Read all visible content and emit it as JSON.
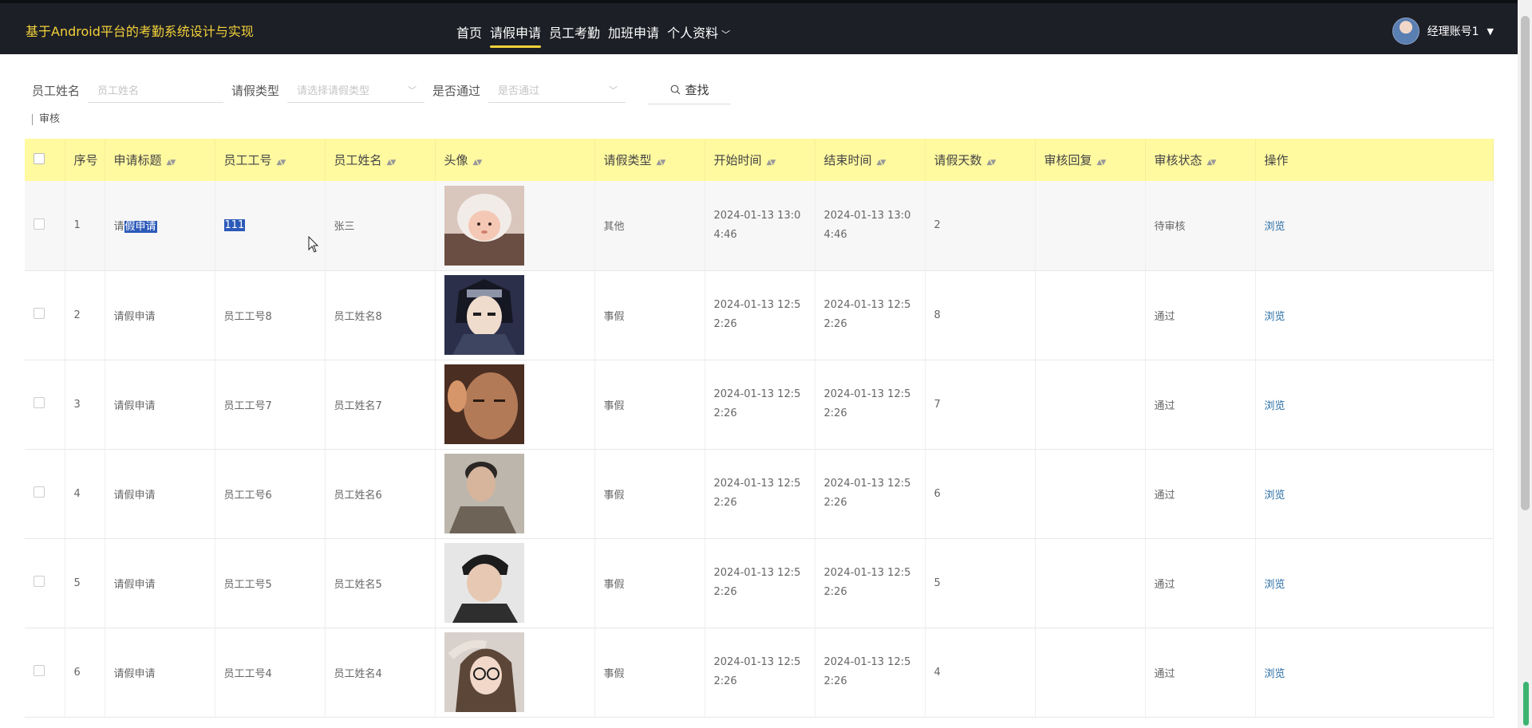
{
  "header": {
    "app_title": "基于Android平台的考勤系统设计与实现",
    "nav": [
      {
        "label": "首页",
        "active": false
      },
      {
        "label": "请假申请",
        "active": true
      },
      {
        "label": "员工考勤",
        "active": false
      },
      {
        "label": "加班申请",
        "active": false
      },
      {
        "label": "个人资料",
        "active": false
      }
    ],
    "user_name": "经理账号1"
  },
  "filter": {
    "name_label": "员工姓名",
    "name_placeholder": "员工姓名",
    "type_label": "请假类型",
    "type_placeholder": "请选择请假类型",
    "pass_label": "是否通过",
    "pass_placeholder": "是否通过",
    "search_label": "查找"
  },
  "actions": {
    "audit_label": "审核"
  },
  "table": {
    "columns": [
      "序号",
      "申请标题",
      "员工工号",
      "员工姓名",
      "头像",
      "请假类型",
      "开始时间",
      "结束时间",
      "请假天数",
      "审核回复",
      "审核状态",
      "操作"
    ],
    "rows": [
      {
        "no": "1",
        "title_pre": "请",
        "title_hl": "假申请",
        "emp_no": "111",
        "name": "张三",
        "type": "其他",
        "start_1": "2024-01-13 13:0",
        "start_2": "4:46",
        "end_1": "2024-01-13 13:0",
        "end_2": "4:46",
        "days": "2",
        "reply": "",
        "status": "待审核",
        "action": "浏览"
      },
      {
        "no": "2",
        "title": "请假申请",
        "emp_no": "员工工号8",
        "name": "员工姓名8",
        "type": "事假",
        "start_1": "2024-01-13 12:5",
        "start_2": "2:26",
        "end_1": "2024-01-13 12:5",
        "end_2": "2:26",
        "days": "8",
        "reply": "",
        "status": "通过",
        "action": "浏览"
      },
      {
        "no": "3",
        "title": "请假申请",
        "emp_no": "员工工号7",
        "name": "员工姓名7",
        "type": "事假",
        "start_1": "2024-01-13 12:5",
        "start_2": "2:26",
        "end_1": "2024-01-13 12:5",
        "end_2": "2:26",
        "days": "7",
        "reply": "",
        "status": "通过",
        "action": "浏览"
      },
      {
        "no": "4",
        "title": "请假申请",
        "emp_no": "员工工号6",
        "name": "员工姓名6",
        "type": "事假",
        "start_1": "2024-01-13 12:5",
        "start_2": "2:26",
        "end_1": "2024-01-13 12:5",
        "end_2": "2:26",
        "days": "6",
        "reply": "",
        "status": "通过",
        "action": "浏览"
      },
      {
        "no": "5",
        "title": "请假申请",
        "emp_no": "员工工号5",
        "name": "员工姓名5",
        "type": "事假",
        "start_1": "2024-01-13 12:5",
        "start_2": "2:26",
        "end_1": "2024-01-13 12:5",
        "end_2": "2:26",
        "days": "5",
        "reply": "",
        "status": "通过",
        "action": "浏览"
      },
      {
        "no": "6",
        "title": "请假申请",
        "emp_no": "员工工号4",
        "name": "员工姓名4",
        "type": "事假",
        "start_1": "2024-01-13 12:5",
        "start_2": "2:26",
        "end_1": "2024-01-13 12:5",
        "end_2": "2:26",
        "days": "4",
        "reply": "",
        "status": "通过",
        "action": "浏览"
      }
    ]
  },
  "colors": {
    "topbar": "#1d1f26",
    "accent": "#f3d23a",
    "table_header": "#fff9a0",
    "link": "#2a6ea6"
  }
}
